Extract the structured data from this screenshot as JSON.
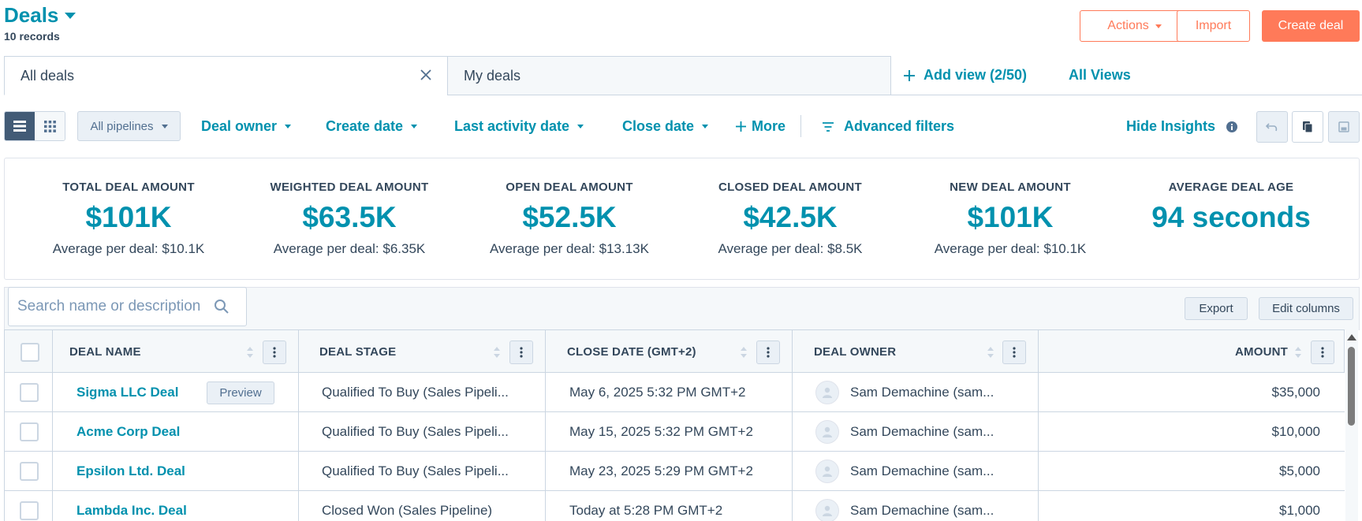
{
  "header": {
    "title": "Deals",
    "record_count": "10 records",
    "actions_label": "Actions",
    "import_label": "Import",
    "create_label": "Create deal"
  },
  "views": {
    "tabs": [
      {
        "label": "All deals",
        "active": true
      },
      {
        "label": "My deals",
        "active": false
      }
    ],
    "add_view_label": "Add view (2/50)",
    "all_views_label": "All Views"
  },
  "filters": {
    "pipeline": "All pipelines",
    "deal_owner": "Deal owner",
    "create_date": "Create date",
    "last_activity": "Last activity date",
    "close_date": "Close date",
    "more": "More",
    "advanced": "Advanced filters",
    "hide_insights": "Hide Insights"
  },
  "insights": [
    {
      "label": "TOTAL DEAL AMOUNT",
      "value": "$101K",
      "sub": "Average per deal: $10.1K"
    },
    {
      "label": "WEIGHTED DEAL AMOUNT",
      "value": "$63.5K",
      "sub": "Average per deal: $6.35K"
    },
    {
      "label": "OPEN DEAL AMOUNT",
      "value": "$52.5K",
      "sub": "Average per deal: $13.13K"
    },
    {
      "label": "CLOSED DEAL AMOUNT",
      "value": "$42.5K",
      "sub": "Average per deal: $8.5K"
    },
    {
      "label": "NEW DEAL AMOUNT",
      "value": "$101K",
      "sub": "Average per deal: $10.1K"
    },
    {
      "label": "AVERAGE DEAL AGE",
      "value": "94 seconds",
      "sub": ""
    }
  ],
  "table": {
    "search_placeholder": "Search name or description",
    "export_label": "Export",
    "edit_columns_label": "Edit columns",
    "preview_label": "Preview",
    "columns": [
      "DEAL NAME",
      "DEAL STAGE",
      "CLOSE DATE (GMT+2)",
      "DEAL OWNER",
      "AMOUNT"
    ],
    "rows": [
      {
        "name": "Sigma LLC Deal",
        "stage": "Qualified To Buy (Sales Pipeli...",
        "close": "May 6, 2025 5:32 PM GMT+2",
        "owner": "Sam Demachine (sam...",
        "amount": "$35,000"
      },
      {
        "name": "Acme Corp Deal",
        "stage": "Qualified To Buy (Sales Pipeli...",
        "close": "May 15, 2025 5:32 PM GMT+2",
        "owner": "Sam Demachine (sam...",
        "amount": "$10,000"
      },
      {
        "name": "Epsilon Ltd. Deal",
        "stage": "Qualified To Buy (Sales Pipeli...",
        "close": "May 23, 2025 5:29 PM GMT+2",
        "owner": "Sam Demachine (sam...",
        "amount": "$5,000"
      },
      {
        "name": "Lambda Inc. Deal",
        "stage": "Closed Won (Sales Pipeline)",
        "close": "Today at 5:28 PM GMT+2",
        "owner": "Sam Demachine (sam...",
        "amount": "$1,000"
      }
    ]
  },
  "colors": {
    "brand_teal": "#0091ae",
    "accent_orange": "#ff7a59",
    "text_dark": "#33475b",
    "border": "#cbd6e2"
  }
}
